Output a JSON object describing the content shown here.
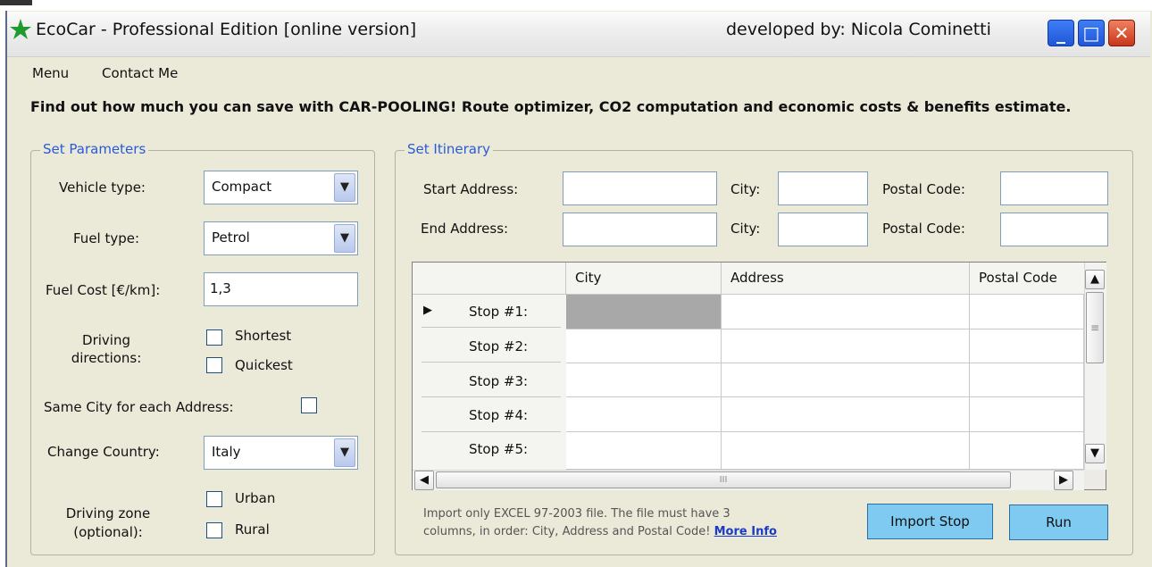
{
  "window": {
    "title": "EcoCar - Professional Edition [online version]",
    "developer": "developed by: Nicola Cominetti",
    "controls": {
      "minimize": "_",
      "maximize": "□",
      "close": "✕"
    },
    "app_icon": "green-star-icon"
  },
  "menu": {
    "items": [
      "Menu",
      "Contact Me"
    ]
  },
  "tagline": "Find out how much you can save with CAR-POOLING! Route optimizer, CO2 computation and economic costs & benefits estimate.",
  "parameters": {
    "group_title": "Set Parameters",
    "vehicle_type": {
      "label": "Vehicle type:",
      "value": "Compact"
    },
    "fuel_type": {
      "label": "Fuel type:",
      "value": "Petrol"
    },
    "fuel_cost": {
      "label": "Fuel Cost [€/km]:",
      "value": "1,3"
    },
    "driving_directions": {
      "label_line1": "Driving",
      "label_line2": "directions:",
      "option1": "Shortest",
      "option2": "Quickest"
    },
    "same_city": {
      "label": "Same City for each Address:"
    },
    "country": {
      "label": "Change Country:",
      "value": "Italy"
    },
    "driving_zone": {
      "label_line1": "Driving zone",
      "label_line2": "(optional):",
      "option1": "Urban",
      "option2": "Rural"
    }
  },
  "itinerary": {
    "group_title": "Set Itinerary",
    "start_address_label": "Start Address:",
    "end_address_label": "End Address:",
    "city_label": "City:",
    "postal_label": "Postal Code:",
    "start_address": "",
    "start_city": "",
    "start_postal": "",
    "end_address": "",
    "end_city": "",
    "end_postal": ""
  },
  "grid": {
    "columns": [
      "City",
      "Address",
      "Postal Code"
    ],
    "rows": [
      "Stop #1:",
      "Stop #2:",
      "Stop #3:",
      "Stop #4:",
      "Stop #5:"
    ],
    "current_row_marker": "▶",
    "scroll": {
      "up": "▲",
      "down": "▼",
      "left": "◀",
      "right": "▶",
      "thumb_grip": "≡",
      "hthumb_grip": "III"
    }
  },
  "import_note": {
    "line1": "Import only EXCEL 97-2003 file. The file must have 3",
    "line2": "columns, in order: City, Address and Postal Code!",
    "more_info": "More Info"
  },
  "buttons": {
    "import": "Import Stop",
    "run": "Run"
  },
  "combo_arrow": "▼",
  "colors": {
    "accent_blue": "#2a5bd7",
    "button_blue": "#7ecaf0",
    "window_bg": "#ebe9d8",
    "close_red": "#c8361a"
  }
}
